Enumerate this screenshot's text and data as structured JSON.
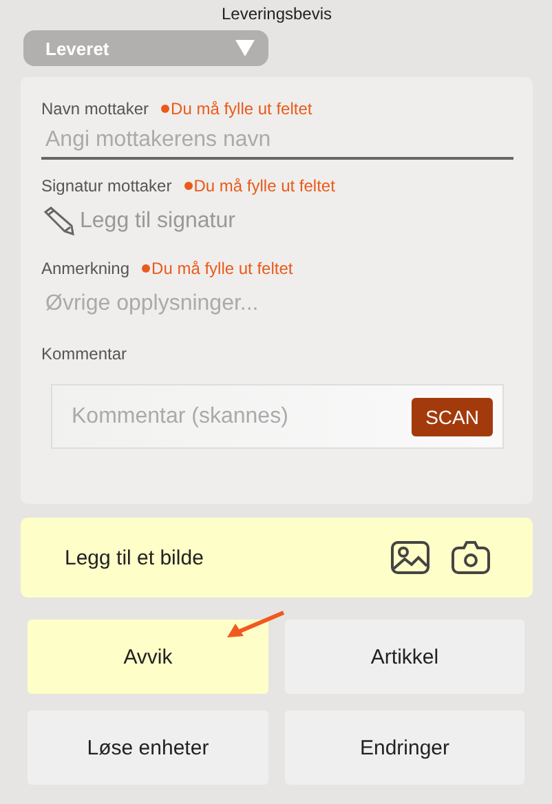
{
  "title": "Leveringsbevis",
  "status_dropdown": {
    "value": "Leveret"
  },
  "form": {
    "fields": [
      {
        "kind": "text",
        "label": "Navn mottaker",
        "error": "Du må fylle ut feltet",
        "placeholder": "Angi mottakerens navn"
      },
      {
        "kind": "signature",
        "label": "Signatur mottaker",
        "error": "Du må fylle ut feltet",
        "action": "Legg til signatur"
      },
      {
        "kind": "note",
        "label": "Anmerkning",
        "error": "Du må fylle ut feltet",
        "placeholder": "Øvrige opplysninger..."
      },
      {
        "kind": "scan",
        "label": "Kommentar",
        "placeholder": "Kommentar (skannes)",
        "button": "SCAN"
      }
    ]
  },
  "photo_card": {
    "label": "Legg til et bilde"
  },
  "buttons": [
    {
      "label": "Avvik",
      "selected": true
    },
    {
      "label": "Artikkel",
      "selected": false
    },
    {
      "label": "Løse enheter",
      "selected": false
    },
    {
      "label": "Endringer",
      "selected": false
    }
  ]
}
